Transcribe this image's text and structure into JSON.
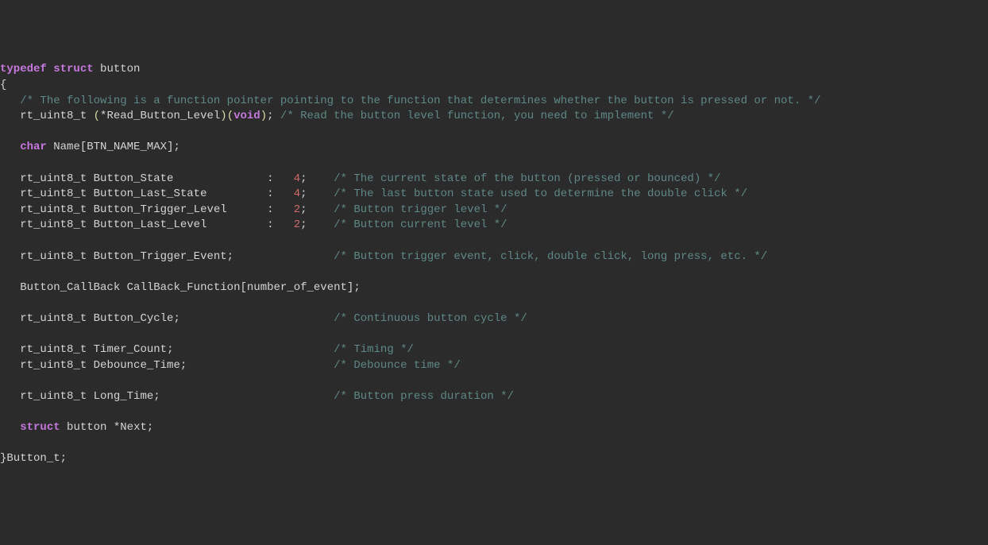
{
  "code": {
    "line1": {
      "typedef": "typedef",
      "struct": "struct",
      "name": "button"
    },
    "line2": {
      "brace": "{"
    },
    "line3": {
      "comment": "/* The following is a function pointer pointing to the function that determines whether the button is pressed or not. */"
    },
    "line4": {
      "type": "rt_uint8_t",
      "paren_open": "(",
      "star": "*",
      "func_name": "Read_Button_Level",
      "paren_close": ")",
      "paren_open2": "(",
      "void": "void",
      "paren_close2": ")",
      "semi": ";",
      "comment": "/* Read the button level function, you need to implement */"
    },
    "line6": {
      "char": "char",
      "name": "Name",
      "bracket_open": "[",
      "macro": "BTN_NAME_MAX",
      "bracket_close": "]",
      "semi": ";"
    },
    "line8": {
      "type": "rt_uint8_t",
      "name": "Button_State",
      "colon": ":",
      "num": "4",
      "semi": ";",
      "comment": "/* The current state of the button (pressed or bounced) */"
    },
    "line9": {
      "type": "rt_uint8_t",
      "name": "Button_Last_State",
      "colon": ":",
      "num": "4",
      "semi": ";",
      "comment": "/* The last button state used to determine the double click */"
    },
    "line10": {
      "type": "rt_uint8_t",
      "name": "Button_Trigger_Level",
      "colon": ":",
      "num": "2",
      "semi": ";",
      "comment": "/* Button trigger level */"
    },
    "line11": {
      "type": "rt_uint8_t",
      "name": "Button_Last_Level",
      "colon": ":",
      "num": "2",
      "semi": ";",
      "comment": "/* Button current level */"
    },
    "line13": {
      "type": "rt_uint8_t",
      "name": "Button_Trigger_Event",
      "semi": ";",
      "comment": "/* Button trigger event, click, double click, long press, etc. */"
    },
    "line15": {
      "type": "Button_CallBack",
      "name": "CallBack_Function",
      "bracket_open": "[",
      "macro": "number_of_event",
      "bracket_close": "]",
      "semi": ";"
    },
    "line17": {
      "type": "rt_uint8_t",
      "name": "Button_Cycle",
      "semi": ";",
      "comment": "/* Continuous button cycle */"
    },
    "line19": {
      "type": "rt_uint8_t",
      "name": "Timer_Count",
      "semi": ";",
      "comment": "/* Timing */"
    },
    "line20": {
      "type": "rt_uint8_t",
      "name": "Debounce_Time",
      "semi": ";",
      "comment": "/* Debounce time */"
    },
    "line22": {
      "type": "rt_uint8_t",
      "name": "Long_Time",
      "semi": ";",
      "comment": "/* Button press duration */"
    },
    "line24": {
      "struct": "struct",
      "type": "button",
      "star": "*",
      "name": "Next",
      "semi": ";"
    },
    "line26": {
      "brace": "}",
      "name": "Button_t",
      "semi": ";"
    }
  }
}
